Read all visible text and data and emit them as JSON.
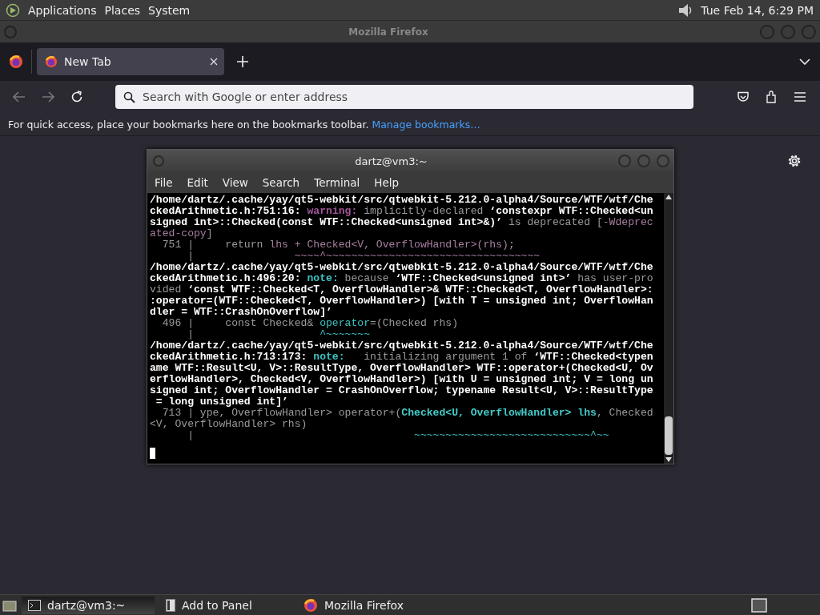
{
  "top_panel": {
    "menus": [
      "Applications",
      "Places",
      "System"
    ],
    "clock": "Tue Feb 14,  6:29 PM"
  },
  "browser": {
    "title": "Mozilla Firefox",
    "tabs": [
      {
        "label": "New Tab",
        "selected": true
      }
    ],
    "address_bar": {
      "placeholder": "Search with Google or enter address"
    },
    "bookmarks_bar": {
      "message": "For quick access, place your bookmarks here on the bookmarks toolbar.",
      "link": "Manage bookmarks…"
    }
  },
  "terminal": {
    "title": "dartz@vm3:~",
    "menu": [
      "File",
      "Edit",
      "View",
      "Search",
      "Terminal",
      "Help"
    ],
    "lines": [
      [
        {
          "kind": "bold",
          "text": "/home/dartz/.cache/yay/qt5-webkit/src/qtwebkit-5.212.0-alpha4/Source/WTF/wtf/Che"
        }
      ],
      [
        {
          "kind": "bold",
          "text": "ckedArithmetic.h:751:16: "
        },
        {
          "kind": "warn",
          "text": "warning:"
        },
        {
          "kind": "dim",
          "text": " implicitly-declared "
        },
        {
          "kind": "bold",
          "text": "‘constexpr WTF::Checked<un"
        }
      ],
      [
        {
          "kind": "bold",
          "text": "signed int>::Checked(const WTF::Checked<unsigned int>&)’"
        },
        {
          "kind": "dim",
          "text": " is deprecated ["
        },
        {
          "kind": "flag",
          "text": "-Wdeprec"
        }
      ],
      [
        {
          "kind": "flag",
          "text": "ated-copy"
        },
        {
          "kind": "dim",
          "text": "]"
        }
      ],
      [
        {
          "kind": "dim",
          "text": "  751 |     return "
        },
        {
          "kind": "flag",
          "text": "lhs + Checked<V, OverflowHandler>(rhs)"
        },
        {
          "kind": "dim",
          "text": ";"
        }
      ],
      [
        {
          "kind": "dim",
          "text": "      |                "
        },
        {
          "kind": "flag",
          "text": "~~~~^~~~~~~~~~~~~~~~~~~~~~~~~~~~~~~~~~~"
        }
      ],
      [
        {
          "kind": "bold",
          "text": "/home/dartz/.cache/yay/qt5-webkit/src/qtwebkit-5.212.0-alpha4/Source/WTF/wtf/Che"
        }
      ],
      [
        {
          "kind": "bold",
          "text": "ckedArithmetic.h:496:20: "
        },
        {
          "kind": "note",
          "text": "note:"
        },
        {
          "kind": "dim",
          "text": " because "
        },
        {
          "kind": "bold",
          "text": "‘WTF::Checked<unsigned int>’"
        },
        {
          "kind": "dim",
          "text": " has user-pro"
        }
      ],
      [
        {
          "kind": "dim",
          "text": "vided "
        },
        {
          "kind": "bold",
          "text": "‘const WTF::Checked<T, OverflowHandler>& WTF::Checked<T, OverflowHandler>:"
        }
      ],
      [
        {
          "kind": "bold",
          "text": ":operator=(WTF::Checked<T, OverflowHandler>) [with T = unsigned int; OverflowHan"
        }
      ],
      [
        {
          "kind": "bold",
          "text": "dler = WTF::CrashOnOverflow]’"
        }
      ],
      [
        {
          "kind": "dim",
          "text": "  496 |     const Checked& "
        },
        {
          "kind": "cyan",
          "text": "operator"
        },
        {
          "kind": "dim",
          "text": "=(Checked rhs)"
        }
      ],
      [
        {
          "kind": "dim",
          "text": "      |                    "
        },
        {
          "kind": "cyan",
          "text": "^~~~~~~~"
        }
      ],
      [
        {
          "kind": "bold",
          "text": "/home/dartz/.cache/yay/qt5-webkit/src/qtwebkit-5.212.0-alpha4/Source/WTF/wtf/Che"
        }
      ],
      [
        {
          "kind": "bold",
          "text": "ckedArithmetic.h:713:173: "
        },
        {
          "kind": "note",
          "text": "note:"
        },
        {
          "kind": "dim",
          "text": "   initializing argument 1 of "
        },
        {
          "kind": "bold",
          "text": "‘WTF::Checked<typen"
        }
      ],
      [
        {
          "kind": "bold",
          "text": "ame WTF::Result<U, V>::ResultType, OverflowHandler> WTF::operator+(Checked<U, Ov"
        }
      ],
      [
        {
          "kind": "bold",
          "text": "erflowHandler>, Checked<V, OverflowHandler>) [with U = unsigned int; V = long un"
        }
      ],
      [
        {
          "kind": "bold",
          "text": "signed int; OverflowHandler = CrashOnOverflow; typename Result<U, V>::ResultType"
        }
      ],
      [
        {
          "kind": "bold",
          "text": " = long unsigned int]’"
        }
      ],
      [
        {
          "kind": "dim",
          "text": "  713 | ype, OverflowHandler> operator+("
        },
        {
          "kind": "cyanb",
          "text": "Checked<U, OverflowHandler> lhs"
        },
        {
          "kind": "dim",
          "text": ", Checked"
        }
      ],
      [
        {
          "kind": "dim",
          "text": "<V, OverflowHandler> rhs)"
        }
      ],
      [
        {
          "kind": "dim",
          "text": "      |                                   "
        },
        {
          "kind": "cyan",
          "text": "~~~~~~~~~~~~~~~~~~~~~~~~~~~~^~~"
        }
      ]
    ]
  },
  "taskbar": {
    "items": [
      {
        "kind": "terminal",
        "label": "dartz@vm3:~",
        "selected": true
      },
      {
        "kind": "panel",
        "label": "Add to Panel",
        "selected": false
      },
      {
        "kind": "firefox",
        "label": "Mozilla Firefox",
        "selected": false
      }
    ]
  }
}
